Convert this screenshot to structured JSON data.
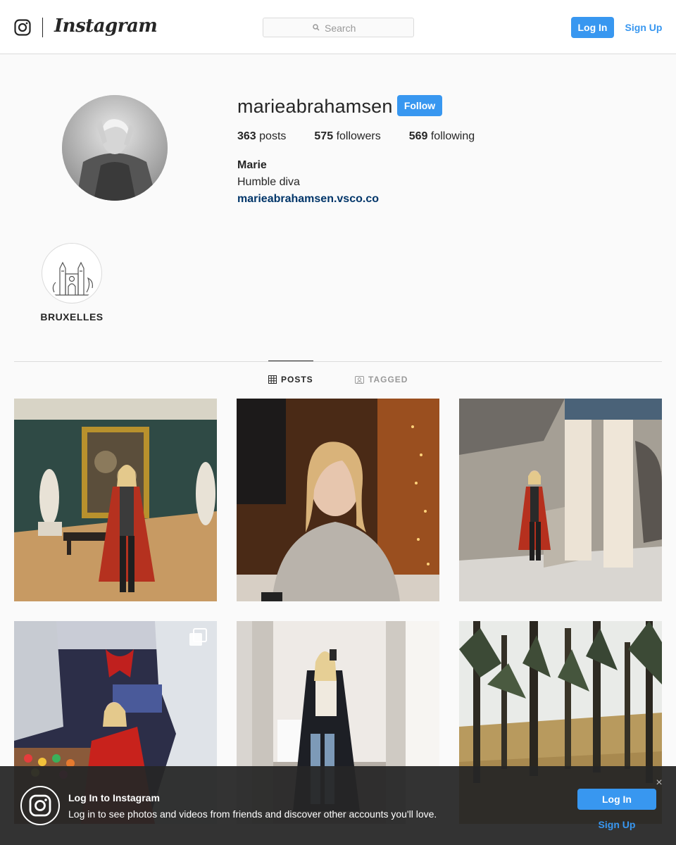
{
  "nav": {
    "brand": "Instagram",
    "search_placeholder": "Search",
    "login_label": "Log In",
    "signup_label": "Sign Up"
  },
  "profile": {
    "username": "marieabrahamsen",
    "follow_label": "Follow",
    "posts_count": "363",
    "posts_label": "posts",
    "followers_count": "575",
    "followers_label": "followers",
    "following_count": "569",
    "following_label": "following",
    "full_name": "Marie",
    "bio": "Humble diva",
    "website": "marieabrahamsen.vsco.co"
  },
  "highlights": [
    {
      "label": "BRUXELLES",
      "icon": "cathedral-illustration"
    }
  ],
  "tabs": [
    {
      "label": "POSTS",
      "icon": "grid-icon",
      "active": true
    },
    {
      "label": "TAGGED",
      "icon": "tagged-icon",
      "active": false
    }
  ],
  "posts": [
    {
      "description": "woman in red coat in museum gallery",
      "multiple": false
    },
    {
      "description": "woman in grey sweater at cafe",
      "multiple": false
    },
    {
      "description": "woman in red coat by marble columns",
      "multiple": false
    },
    {
      "description": "woman in red coat at christmas market",
      "multiple": true
    },
    {
      "description": "mirror selfie in black coat",
      "multiple": false
    },
    {
      "description": "pine forest with dry grass",
      "multiple": false
    }
  ],
  "banner": {
    "title": "Log In to Instagram",
    "text": "Log in to see photos and videos from friends and discover other accounts you'll love.",
    "login_label": "Log In",
    "signup_label": "Sign Up",
    "close_glyph": "×"
  },
  "colors": {
    "accent": "#3897f0",
    "link": "#003569",
    "text": "#262626",
    "background": "#fafafa"
  }
}
